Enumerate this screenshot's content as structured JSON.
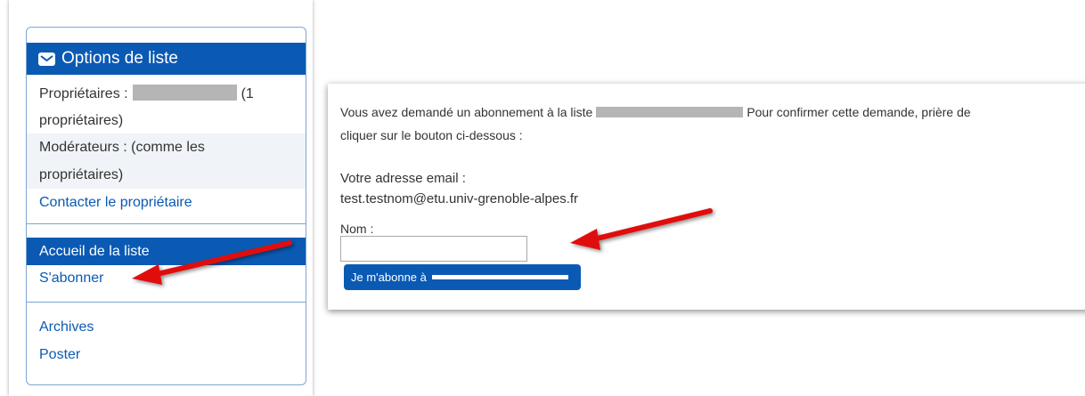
{
  "sidebar": {
    "title": "Options de liste",
    "owners_label": "Propriétaires :",
    "owners_count": "(1",
    "owners_suffix": "propriétaires)",
    "moderators_line1": "Modérateurs : (comme les",
    "moderators_line2": "propriétaires)",
    "contact_owner": "Contacter le propriétaire",
    "nav": {
      "home": "Accueil de la liste",
      "subscribe": "S'abonner",
      "archives": "Archives",
      "post": "Poster"
    }
  },
  "panel": {
    "intro_start": "Vous avez demandé un abonnement à la liste",
    "intro_end": "Pour confirmer cette demande, prière de",
    "intro_line2": "cliquer sur le bouton ci-dessous :",
    "email_label": "Votre adresse email :",
    "email_value": "test.testnom@etu.univ-grenoble-alpes.fr",
    "name_label": "Nom :",
    "name_value": "",
    "subscribe_button": "Je m'abonne à"
  },
  "colors": {
    "primary": "#0a5ab4",
    "arrow": "#e01010",
    "redaction": "#b5b5b5"
  },
  "icons": [
    "envelope-icon",
    "annotation-arrow"
  ]
}
